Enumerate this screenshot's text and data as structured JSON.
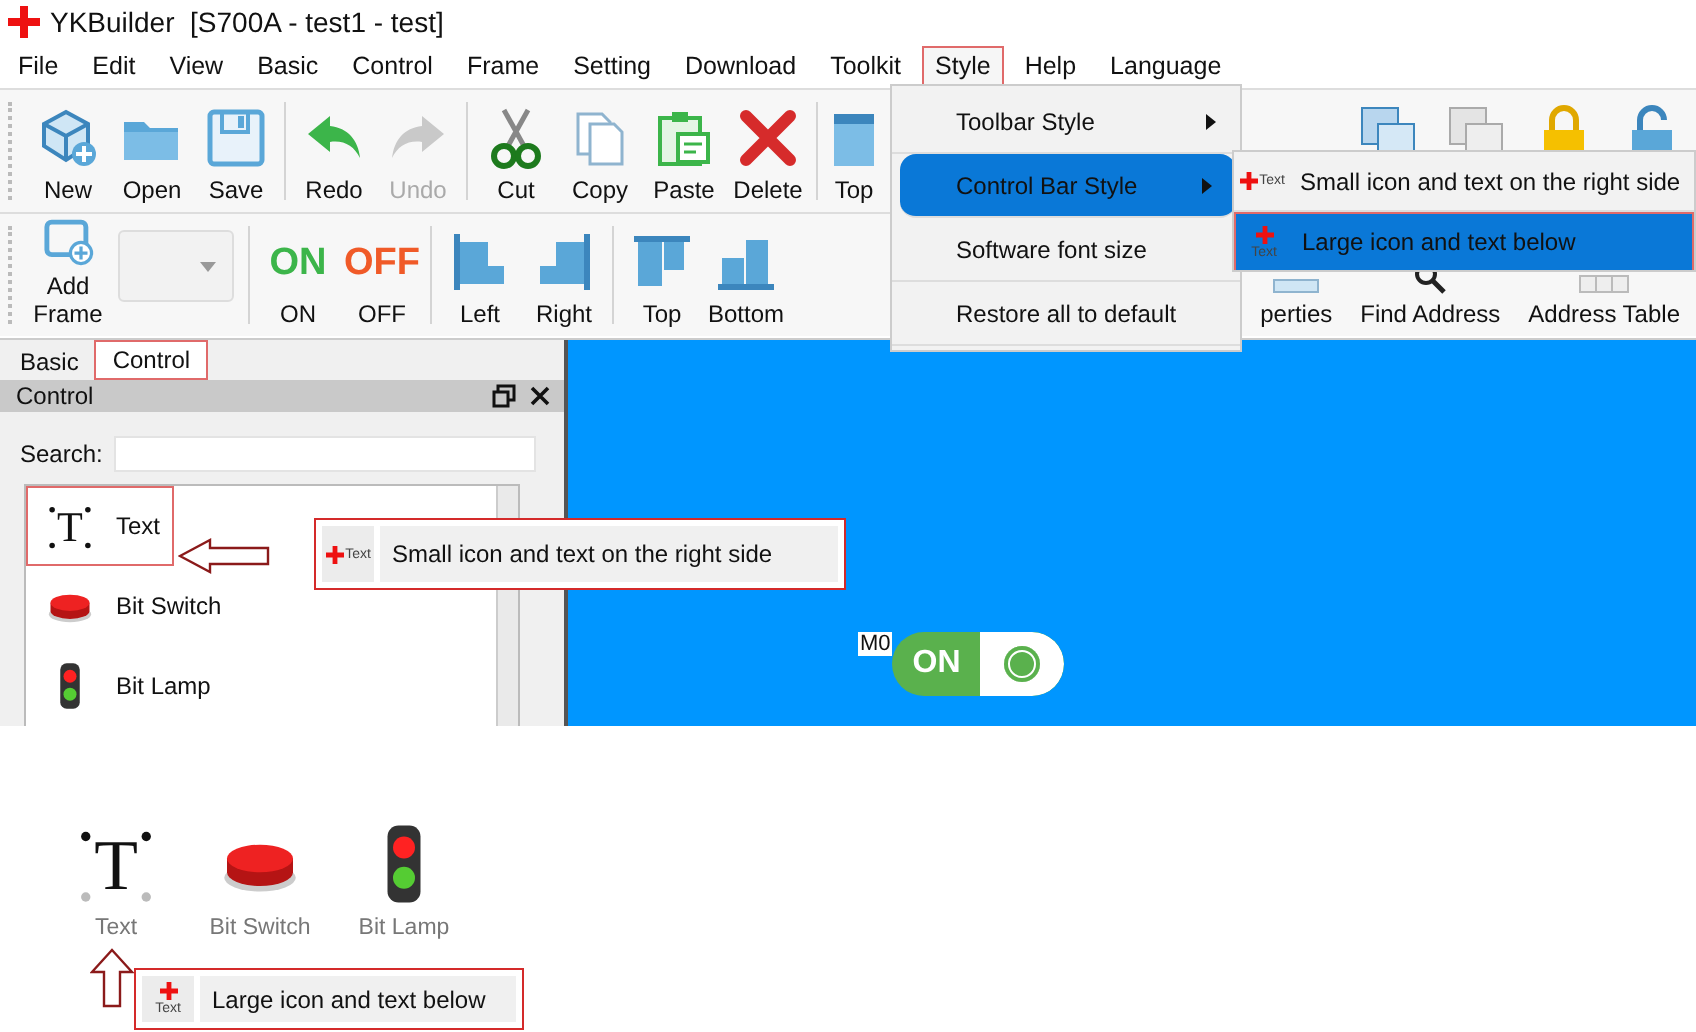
{
  "window": {
    "title": "YKBuilder  [S700A - test1 - test]"
  },
  "menu_bar": [
    {
      "label": "File",
      "selected": false
    },
    {
      "label": "Edit",
      "selected": false
    },
    {
      "label": "View",
      "selected": false
    },
    {
      "label": "Basic",
      "selected": false
    },
    {
      "label": "Control",
      "selected": false
    },
    {
      "label": "Frame",
      "selected": false
    },
    {
      "label": "Setting",
      "selected": false
    },
    {
      "label": "Download",
      "selected": false
    },
    {
      "label": "Toolkit",
      "selected": false
    },
    {
      "label": "Style",
      "selected": true
    },
    {
      "label": "Help",
      "selected": false
    },
    {
      "label": "Language",
      "selected": false
    }
  ],
  "toolbar": [
    {
      "label": "New",
      "kind": "new",
      "disabled": false
    },
    {
      "label": "Open",
      "kind": "open",
      "disabled": false
    },
    {
      "label": "Save",
      "kind": "save",
      "disabled": false
    },
    {
      "kind": "separator"
    },
    {
      "label": "Redo",
      "kind": "redo",
      "disabled": false
    },
    {
      "label": "Undo",
      "kind": "undo",
      "disabled": true
    },
    {
      "kind": "separator"
    },
    {
      "label": "Cut",
      "kind": "cut",
      "disabled": false
    },
    {
      "label": "Copy",
      "kind": "copy",
      "disabled": false
    },
    {
      "label": "Paste",
      "kind": "paste",
      "disabled": false
    },
    {
      "label": "Delete",
      "kind": "delete",
      "disabled": false
    },
    {
      "kind": "separator"
    },
    {
      "label": "Top",
      "kind": "top",
      "disabled": false
    }
  ],
  "control_toolbar": [
    {
      "label": "Add Frame",
      "kind": "addframe"
    },
    {
      "kind": "combo"
    },
    {
      "kind": "separator"
    },
    {
      "label": "ON",
      "glyph": "ON",
      "kind": "on"
    },
    {
      "label": "OFF",
      "glyph": "OFF",
      "kind": "off"
    },
    {
      "kind": "separator"
    },
    {
      "label": "Left",
      "kind": "left"
    },
    {
      "label": "Right",
      "kind": "right"
    },
    {
      "kind": "separator"
    },
    {
      "label": "Top",
      "kind": "align-top"
    },
    {
      "label": "Bottom",
      "kind": "bottom"
    },
    {
      "kind": "gap"
    },
    {
      "label": "perties",
      "kind": "properties"
    },
    {
      "label": "Find Address",
      "kind": "find"
    },
    {
      "label": "Address Table",
      "kind": "table"
    }
  ],
  "panel_tabs": [
    {
      "label": "Basic",
      "selected": false
    },
    {
      "label": "Control",
      "selected": true
    }
  ],
  "panel": {
    "title": "Control",
    "search_label": "Search:",
    "items": [
      {
        "label": "Text",
        "kind": "text",
        "glyph": "T",
        "selected": true
      },
      {
        "label": "Bit Switch",
        "kind": "switch",
        "selected": false
      },
      {
        "label": "Bit Lamp",
        "kind": "lamp",
        "selected": false
      }
    ]
  },
  "canvas": {
    "toggle": {
      "address": "M0",
      "text": "ON",
      "on": true
    }
  },
  "style_menu": {
    "items": [
      {
        "label": "Toolbar Style",
        "submenu": true,
        "selected": false
      },
      {
        "label": "Control Bar Style",
        "submenu": true,
        "selected": true
      },
      {
        "label": "Software font size",
        "submenu": false,
        "selected": false
      },
      {
        "label": "Restore all to default",
        "submenu": false,
        "selected": false
      }
    ],
    "submenu": [
      {
        "label": "Small icon and text on the right side",
        "kind": "small",
        "icon_caption": "Text",
        "selected": false
      },
      {
        "label": "Large icon and text below",
        "kind": "large",
        "icon_caption": "Text",
        "selected": true
      }
    ]
  },
  "preview": [
    {
      "label": "Text",
      "kind": "text",
      "glyph": "T"
    },
    {
      "label": "Bit Switch",
      "kind": "switch"
    },
    {
      "label": "Bit Lamp",
      "kind": "lamp"
    }
  ],
  "callouts": [
    {
      "text": "Small icon and text on the right side",
      "kind": "small",
      "icon_caption": "Text"
    },
    {
      "text": "Large icon and text below",
      "kind": "large",
      "icon_caption": "Text"
    }
  ]
}
